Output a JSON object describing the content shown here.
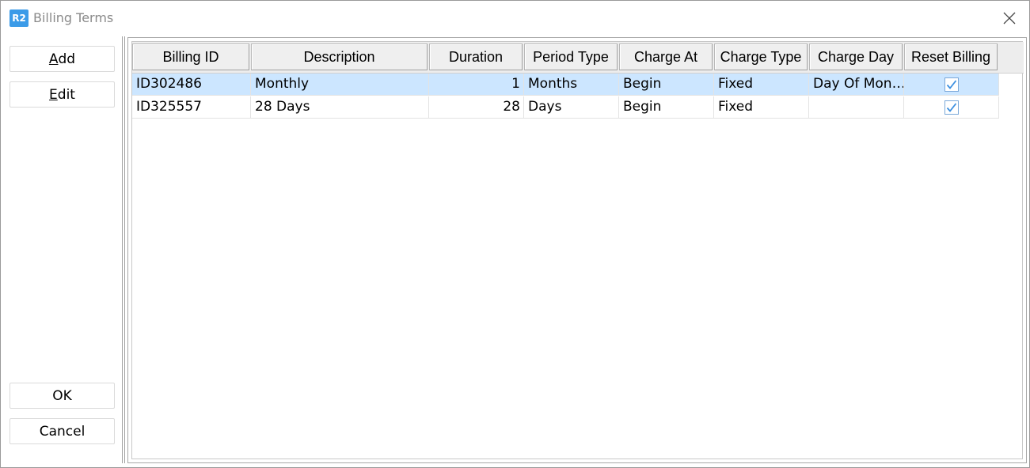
{
  "window": {
    "app_icon_text": "R2",
    "title": "Billing Terms"
  },
  "actions": {
    "add_prefix": "A",
    "add_rest": "dd",
    "edit_prefix": "E",
    "edit_rest": "dit",
    "ok_label": "OK",
    "cancel_label": "Cancel"
  },
  "table": {
    "columns": [
      "Billing ID",
      "Description",
      "Duration",
      "Period Type",
      "Charge At",
      "Charge Type",
      "Charge Day",
      "Reset Billing"
    ],
    "rows": [
      {
        "billing_id": "ID302486",
        "description": "Monthly",
        "duration": "1",
        "period_type": "Months",
        "charge_at": "Begin",
        "charge_type": "Fixed",
        "charge_day": "Day Of Mon…",
        "reset_billing": true,
        "selected": true
      },
      {
        "billing_id": "ID325557",
        "description": "28 Days",
        "duration": "28",
        "period_type": "Days",
        "charge_at": "Begin",
        "charge_type": "Fixed",
        "charge_day": "",
        "reset_billing": true,
        "selected": false
      }
    ]
  },
  "colors": {
    "accent": "#3b9be8",
    "selection": "#cce6ff",
    "check": "#3b8fe0"
  }
}
